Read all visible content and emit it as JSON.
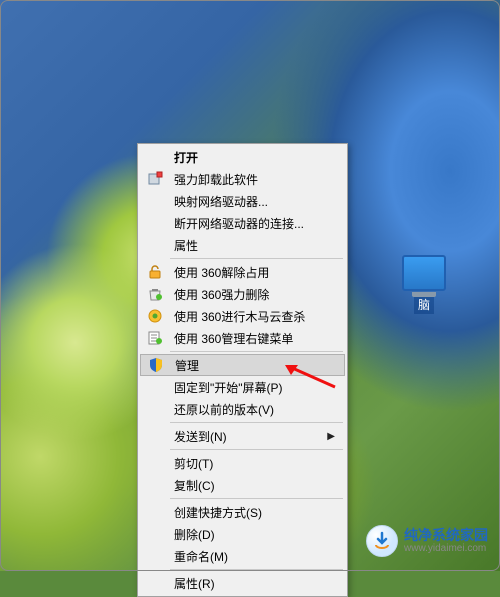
{
  "desktopIcon": {
    "label": "脑"
  },
  "menu": {
    "open": "打开",
    "uninstall": "强力卸载此软件",
    "mapDrive": "映射网络驱动器...",
    "disconnect": "断开网络驱动器的连接...",
    "props1": "属性",
    "s360unlock": "使用 360解除占用",
    "s360delete": "使用 360强力删除",
    "s360trojan": "使用 360进行木马云查杀",
    "s360rclick": "使用 360管理右键菜单",
    "manage": "管理",
    "pinStart": "固定到\"开始\"屏幕(P)",
    "restore": "还原以前的版本(V)",
    "sendTo": "发送到(N)",
    "cut": "剪切(T)",
    "copy": "复制(C)",
    "shortcut": "创建快捷方式(S)",
    "delete": "删除(D)",
    "rename": "重命名(M)",
    "props2": "属性(R)"
  },
  "watermark": {
    "title": "纯净系统家园",
    "url": "www.yidaimei.com"
  }
}
